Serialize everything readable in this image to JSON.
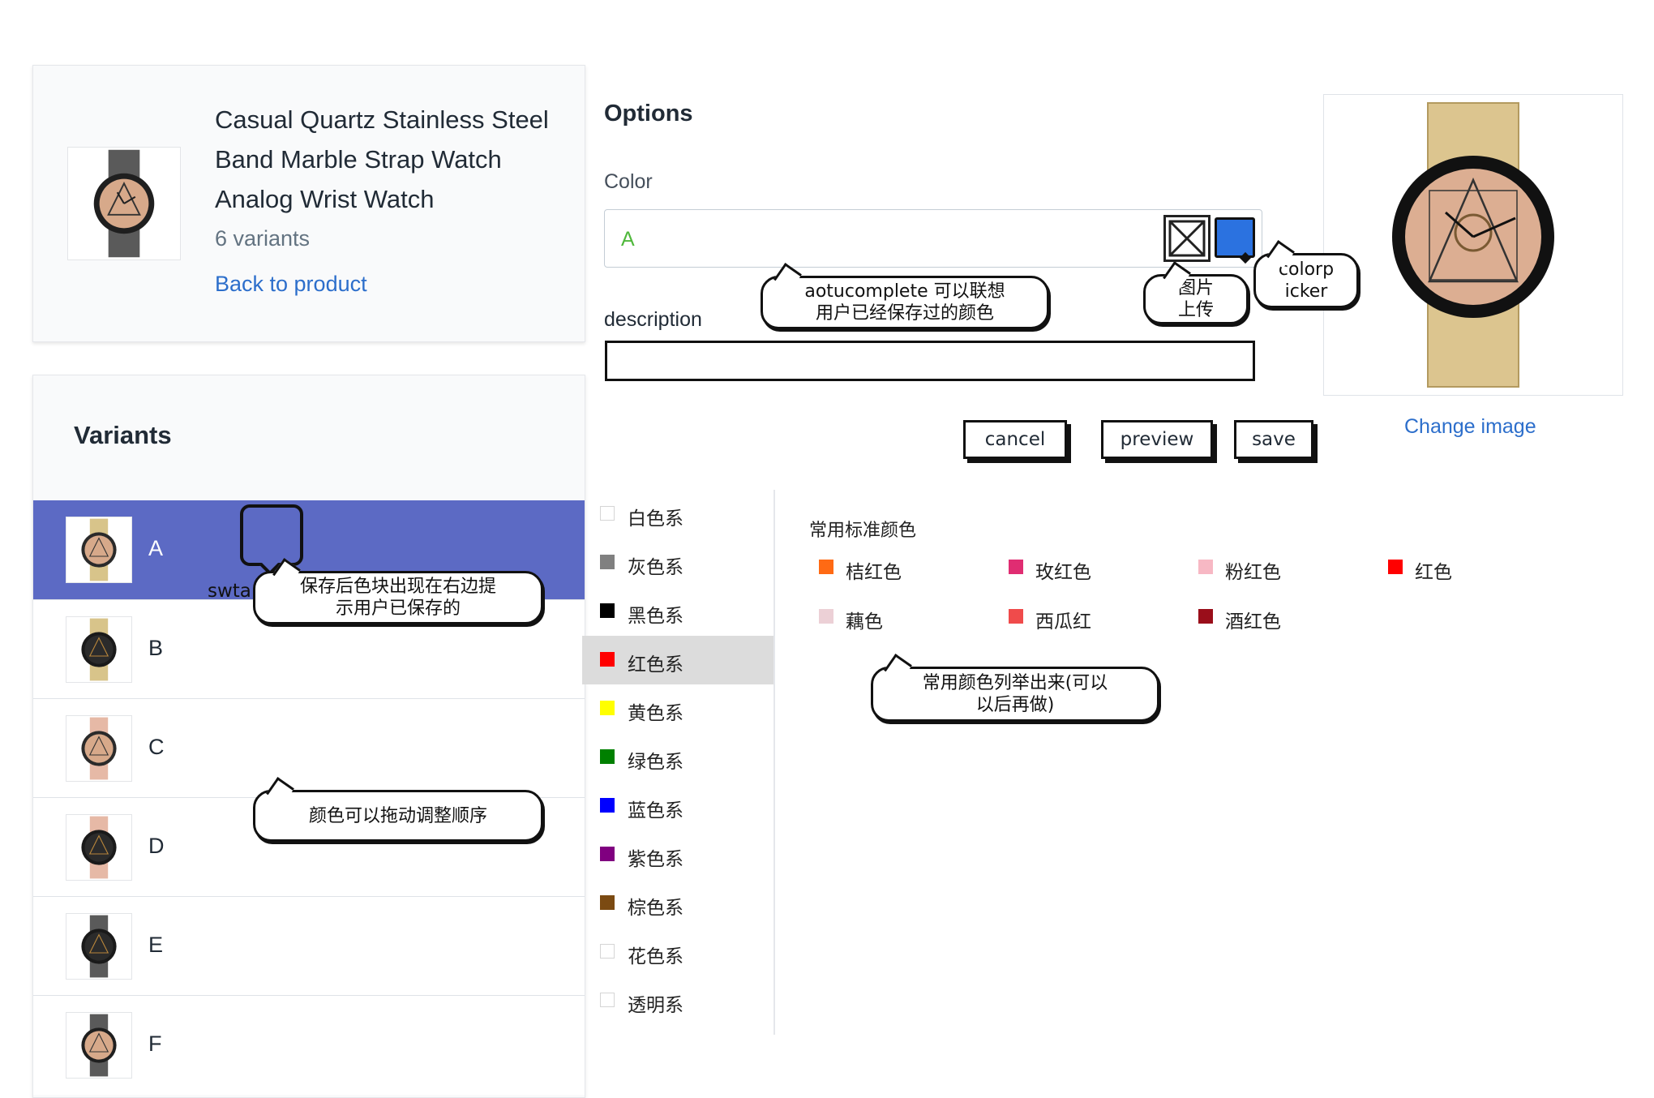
{
  "product": {
    "title": "Casual Quartz Stainless Steel Band Marble Strap Watch Analog Wrist Watch",
    "variant_count": "6 variants",
    "back_link": "Back to product"
  },
  "variants": {
    "heading": "Variants",
    "items": [
      {
        "name": "A",
        "selected": true
      },
      {
        "name": "B"
      },
      {
        "name": "C"
      },
      {
        "name": "D"
      },
      {
        "name": "E"
      },
      {
        "name": "F"
      }
    ]
  },
  "options": {
    "title": "Options",
    "color_label": "Color",
    "color_value": "A",
    "description_label": "description",
    "description_value": "",
    "image_upload_icon": "image-placeholder-icon",
    "picker_color": "#2b72e0"
  },
  "buttons": {
    "cancel": "cancel",
    "preview": "preview",
    "save": "save"
  },
  "preview": {
    "change_image": "Change image"
  },
  "color_families": [
    {
      "label": "白色系",
      "color": "#ffffff",
      "outline": true
    },
    {
      "label": "灰色系",
      "color": "#808080"
    },
    {
      "label": "黑色系",
      "color": "#000000"
    },
    {
      "label": "红色系",
      "color": "#ff0000",
      "active": true
    },
    {
      "label": "黄色系",
      "color": "#ffff00"
    },
    {
      "label": "绿色系",
      "color": "#008000"
    },
    {
      "label": "蓝色系",
      "color": "#0000ff"
    },
    {
      "label": "紫色系",
      "color": "#800080"
    },
    {
      "label": "棕色系",
      "color": "#7b4a12"
    },
    {
      "label": "花色系",
      "color": "#ffffff",
      "outline": true
    },
    {
      "label": "透明系",
      "color": "#ffffff",
      "outline": true
    }
  ],
  "standard_colors": {
    "title": "常用标准颜色",
    "items": [
      {
        "label": "桔红色",
        "color": "#ff6a14"
      },
      {
        "label": "玫红色",
        "color": "#e02d72"
      },
      {
        "label": "粉红色",
        "color": "#f7b8c4"
      },
      {
        "label": "红色",
        "color": "#ff0000"
      },
      {
        "label": "藕色",
        "color": "#ecd0d6"
      },
      {
        "label": "西瓜红",
        "color": "#f04b4b"
      },
      {
        "label": "酒红色",
        "color": "#9a0e1a"
      }
    ]
  },
  "annotations": {
    "autocomplete_line1": "aotucomplete 可以联想",
    "autocomplete_line2": "用户已经保存过的颜色",
    "image_upload_line1": "图片",
    "image_upload_line2": "上传",
    "colorpicker_line1": "colorp",
    "colorpicker_line2": "icker",
    "swatch_label": "swta",
    "swatch_line1": "保存后色块出现在右边提",
    "swatch_line2": "示用户已保存的",
    "drag_order": "颜色可以拖动调整顺序",
    "common_colors_line1": "常用颜色列举出来(可以",
    "common_colors_line2": "以后再做)"
  }
}
